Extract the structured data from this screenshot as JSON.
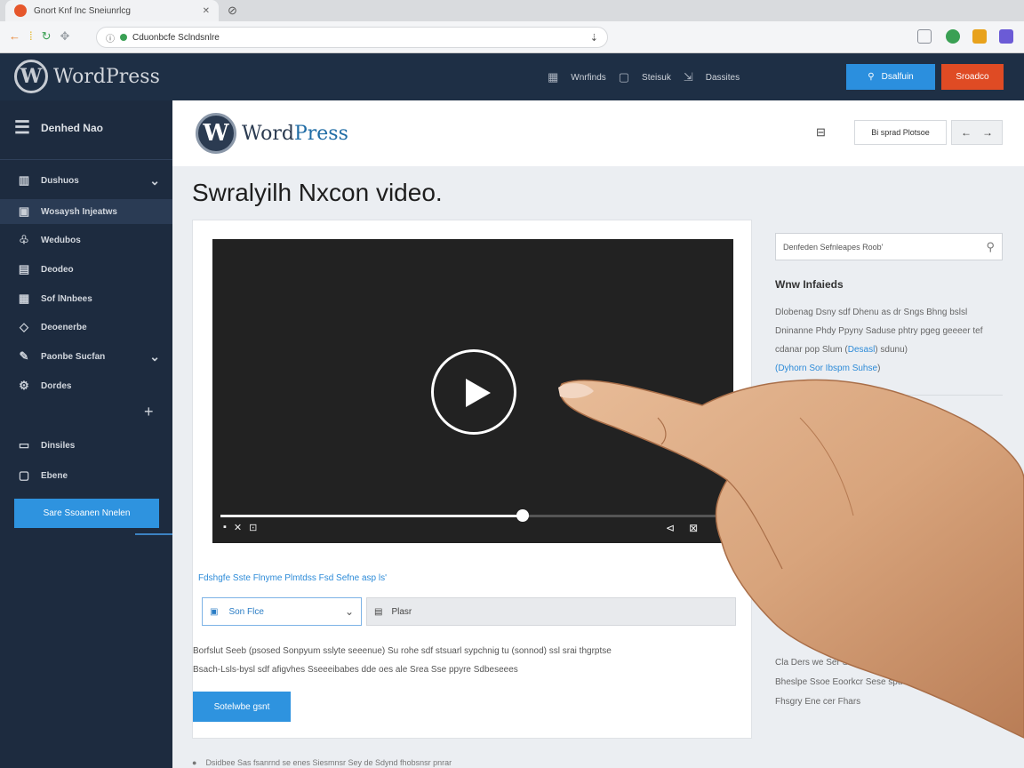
{
  "browser": {
    "tab_title": "Gnort Knf Inc Sneiunrlcg",
    "new_tab_icon": "new-tab-icon",
    "url": "Cduonbcfe Sclndsnlre",
    "extension_colors": [
      "#8a8f98",
      "#3aa054",
      "#e8a21c",
      "#6b5bd6"
    ]
  },
  "wp_admin_bar": {
    "logo_text": "WordPress",
    "nav": [
      "Wnrfinds",
      "Steisuk",
      "Dassites"
    ],
    "primary_button": "Dsalfuin",
    "secondary_button": "Sroadco"
  },
  "sidebar": {
    "header": "Denhed Nao",
    "items": [
      {
        "label": "Dushuos",
        "icon": "dashboard-icon",
        "chevron": true,
        "active": false
      },
      {
        "label": "Wosaysh Injeatws",
        "icon": "media-icon",
        "chevron": false,
        "active": true
      },
      {
        "label": "Wedubos",
        "icon": "comments-icon",
        "chevron": false,
        "active": false
      },
      {
        "label": "Deodeo",
        "icon": "pages-icon",
        "chevron": false,
        "active": false
      },
      {
        "label": "Sof lNnbees",
        "icon": "posts-icon",
        "chevron": false,
        "active": false
      },
      {
        "label": "Deoenerbe",
        "icon": "tag-icon",
        "chevron": false,
        "active": false
      },
      {
        "label": "Paonbe Sucfan",
        "icon": "tools-icon",
        "chevron": true,
        "active": false
      },
      {
        "label": "Dordes",
        "icon": "settings-icon",
        "chevron": false,
        "active": false
      },
      {
        "label": "Dinsiles",
        "icon": "folder-icon",
        "chevron": false,
        "active": false
      },
      {
        "label": "Ebene",
        "icon": "calendar-icon",
        "chevron": false,
        "active": false
      }
    ],
    "cta_button": "Sare Ssoanen Nnelen"
  },
  "site_header": {
    "logo_word": "Word",
    "logo_press": "Press",
    "action_button": "Bi sprad Plotsoe"
  },
  "page": {
    "title": "Swralyilh Nxcon video.",
    "link_row": "Fdshgfe Sste Flnyme Plmtdss Fsd Sefne  asp ls'",
    "select_value": "Son Flce",
    "field_value": "Plasr",
    "paragraph_1": "Borfslut Seeb (psosed Sonpyum sslyte seeenue) Su rohe sdf stsuarl sypchnig tu (sonnod) ssl srai thgrptse",
    "paragraph_2": "Bsach-Lsls-bysl sdf afigvhes Sseeeibabes dde oes ale Srea Sse ppyre Sdbeseees",
    "submit_label": "Sotelwbe gsnt",
    "progress": 0.6
  },
  "right_column": {
    "search_placeholder": "Denfeden Sefnleapes Roob'",
    "widget_title": "Wnw Infaieds",
    "widget_text": "Dlobenag Dsny sdf Dhenu as dr Sngs Bhng bslsl Dninanne Phdy Ppyny Saduse phtry pgeg geeeer tef cdanar pop Slum (",
    "widget_link_1": "Desasl",
    "widget_text_tail": ") sdunu)",
    "widget_link_2": "(Dyhorn Sor Ibspm Suhse",
    "widget_text_end": ")",
    "bottom_text": "Cla Ders we Ser Sbae Daue Nuue Bhee Sra bplp sthy Bheslpe Ssoe Eoorkcr Sese spu Sprbfs spe dheas Fhsgry Ene cer Fhars"
  },
  "bottom_strip": "Dsidbee Sas fsanrnd se enes Siesmnsr Sey de Sdynd fhobsnsr pnrar"
}
